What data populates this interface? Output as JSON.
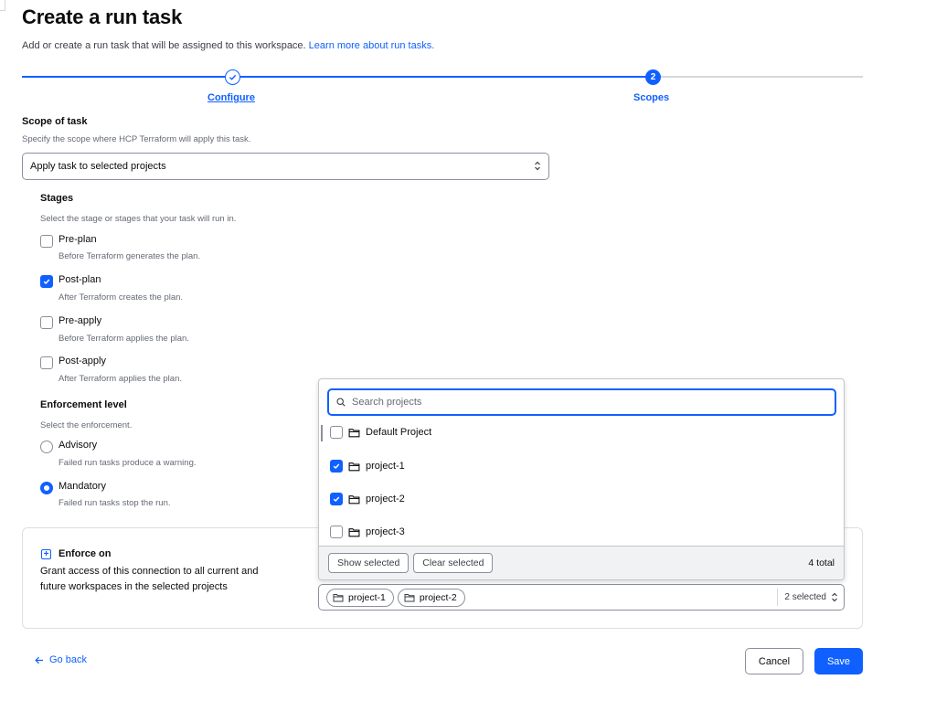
{
  "header": {
    "title": "Create a run task",
    "subtitle": "Add or create a run task that will be assigned to this workspace.",
    "learn_more": "Learn more about run tasks."
  },
  "stepper": {
    "steps": [
      {
        "label": "Configure",
        "state": "complete"
      },
      {
        "label": "Scopes",
        "number": "2",
        "state": "current"
      }
    ]
  },
  "scope": {
    "label": "Scope of task",
    "hint": "Specify the scope where HCP Terraform will apply this task.",
    "selected": "Apply task to selected projects"
  },
  "stages": {
    "label": "Stages",
    "hint": "Select the stage or stages that your task will run in.",
    "options": [
      {
        "label": "Pre-plan",
        "help": "Before Terraform generates the plan.",
        "checked": false
      },
      {
        "label": "Post-plan",
        "help": "After Terraform creates the plan.",
        "checked": true
      },
      {
        "label": "Pre-apply",
        "help": "Before Terraform applies the plan.",
        "checked": false
      },
      {
        "label": "Post-apply",
        "help": "After Terraform applies the plan.",
        "checked": false
      }
    ]
  },
  "enforcement": {
    "label": "Enforcement level",
    "hint": "Select the enforcement.",
    "options": [
      {
        "label": "Advisory",
        "help": "Failed run tasks produce a warning.",
        "selected": false
      },
      {
        "label": "Mandatory",
        "help": "Failed run tasks stop the run.",
        "selected": true
      }
    ]
  },
  "enforce_on": {
    "title": "Enforce on",
    "desc_line1": "Grant access of this connection to all current and",
    "desc_line2": "future workspaces in the selected projects",
    "chips": [
      "project-1",
      "project-2"
    ],
    "selected_count": "2 selected"
  },
  "dropdown": {
    "search_placeholder": "Search projects",
    "options": [
      {
        "label": "Default Project",
        "checked": false
      },
      {
        "label": "project-1",
        "checked": true
      },
      {
        "label": "project-2",
        "checked": true
      },
      {
        "label": "project-3",
        "checked": false
      }
    ],
    "show_selected": "Show selected",
    "clear_selected": "Clear selected",
    "total": "4 total"
  },
  "footer": {
    "go_back": "Go back",
    "cancel": "Cancel",
    "save": "Save"
  },
  "colors": {
    "accent": "#1060ff",
    "border": "#8c909c",
    "muted_text": "#656a76"
  }
}
